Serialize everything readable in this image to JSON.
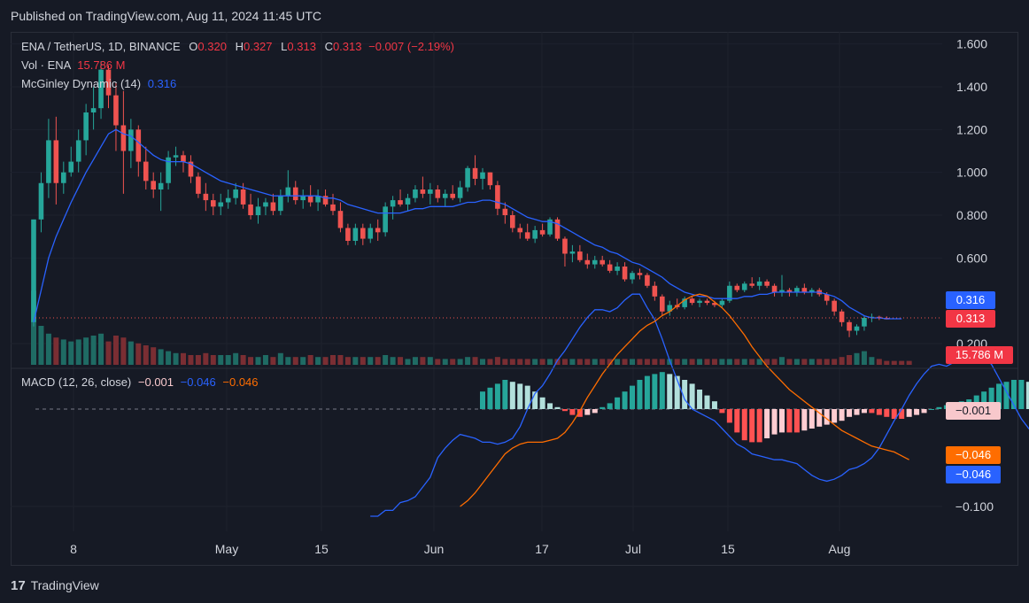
{
  "header": {
    "published": "Published on TradingView.com, Aug 11, 2024 11:45 UTC"
  },
  "footer": {
    "brand": "TradingView"
  },
  "colors": {
    "up": "#26a69a",
    "down": "#ef5350",
    "mcginley": "#2962ff",
    "macd_line": "#2962ff",
    "signal_line": "#ff6d00",
    "bg": "#161a25"
  },
  "legend": {
    "symbol": "ENA / TetherUS, 1D, BINANCE",
    "o_label": "O",
    "o": "0.320",
    "h_label": "H",
    "h": "0.327",
    "l_label": "L",
    "l": "0.313",
    "c_label": "C",
    "c": "0.313",
    "change": "−0.007 (−2.19%)",
    "vol_label": "Vol · ENA",
    "vol": "15.786 M",
    "mg_label": "McGinley Dynamic (14)",
    "mg": "0.316",
    "macd_label": "MACD (12, 26, close)",
    "macd_hist": "−0.001",
    "macd": "−0.046",
    "signal": "−0.046"
  },
  "badges": {
    "mcginley": "0.316",
    "last_price": "0.313",
    "volume": "15.786 M",
    "hist": "−0.001",
    "signal": "−0.046",
    "macd": "−0.046"
  },
  "chart_data": [
    {
      "type": "candlestick",
      "title": "ENA / TetherUS, 1D, BINANCE",
      "x_ticks": [
        "8",
        "May",
        "15",
        "Jun",
        "17",
        "Jul",
        "15",
        "Aug"
      ],
      "y_ticks": [
        "0.200",
        "0.600",
        "0.800",
        "1.000",
        "1.200",
        "1.400",
        "1.600"
      ],
      "ylim": [
        0.15,
        1.65
      ],
      "grid": true,
      "candles": [
        [
          0.3,
          0.78,
          0.28,
          0.78
        ],
        [
          0.78,
          1.0,
          0.72,
          0.95
        ],
        [
          0.95,
          1.25,
          0.88,
          1.15
        ],
        [
          1.15,
          1.26,
          0.85,
          0.95
        ],
        [
          0.95,
          1.05,
          0.9,
          1.0
        ],
        [
          1.0,
          1.12,
          0.98,
          1.05
        ],
        [
          1.05,
          1.2,
          1.0,
          1.15
        ],
        [
          1.15,
          1.32,
          1.08,
          1.28
        ],
        [
          1.28,
          1.4,
          1.2,
          1.3
        ],
        [
          1.3,
          1.52,
          1.25,
          1.48
        ],
        [
          1.48,
          1.5,
          1.3,
          1.36
        ],
        [
          1.36,
          1.42,
          1.1,
          1.22
        ],
        [
          1.22,
          1.38,
          0.9,
          1.1
        ],
        [
          1.1,
          1.25,
          1.02,
          1.2
        ],
        [
          1.2,
          1.22,
          0.98,
          1.05
        ],
        [
          1.05,
          1.12,
          0.92,
          0.96
        ],
        [
          0.96,
          1.0,
          0.88,
          0.92
        ],
        [
          0.92,
          1.0,
          0.82,
          0.95
        ],
        [
          0.95,
          1.1,
          0.92,
          1.07
        ],
        [
          1.07,
          1.12,
          1.03,
          1.08
        ],
        [
          1.08,
          1.1,
          1.0,
          1.05
        ],
        [
          1.05,
          1.08,
          0.95,
          0.98
        ],
        [
          0.98,
          1.0,
          0.88,
          0.9
        ],
        [
          0.9,
          0.95,
          0.82,
          0.87
        ],
        [
          0.87,
          0.9,
          0.8,
          0.84
        ],
        [
          0.84,
          0.9,
          0.8,
          0.86
        ],
        [
          0.86,
          0.92,
          0.83,
          0.88
        ],
        [
          0.88,
          0.95,
          0.85,
          0.92
        ],
        [
          0.92,
          0.95,
          0.83,
          0.85
        ],
        [
          0.85,
          0.9,
          0.78,
          0.8
        ],
        [
          0.8,
          0.88,
          0.76,
          0.84
        ],
        [
          0.84,
          0.88,
          0.8,
          0.86
        ],
        [
          0.86,
          0.9,
          0.8,
          0.82
        ],
        [
          0.82,
          0.92,
          0.8,
          0.89
        ],
        [
          0.89,
          1.01,
          0.86,
          0.93
        ],
        [
          0.93,
          0.96,
          0.85,
          0.87
        ],
        [
          0.87,
          0.92,
          0.83,
          0.89
        ],
        [
          0.89,
          0.94,
          0.84,
          0.86
        ],
        [
          0.86,
          0.92,
          0.82,
          0.89
        ],
        [
          0.89,
          0.92,
          0.84,
          0.85
        ],
        [
          0.85,
          0.9,
          0.8,
          0.82
        ],
        [
          0.82,
          0.86,
          0.72,
          0.74
        ],
        [
          0.74,
          0.76,
          0.66,
          0.68
        ],
        [
          0.68,
          0.76,
          0.66,
          0.74
        ],
        [
          0.74,
          0.76,
          0.66,
          0.69
        ],
        [
          0.69,
          0.76,
          0.67,
          0.74
        ],
        [
          0.74,
          0.78,
          0.68,
          0.72
        ],
        [
          0.72,
          0.86,
          0.7,
          0.84
        ],
        [
          0.84,
          0.89,
          0.78,
          0.87
        ],
        [
          0.87,
          0.92,
          0.84,
          0.85
        ],
        [
          0.85,
          0.9,
          0.82,
          0.88
        ],
        [
          0.88,
          0.94,
          0.86,
          0.92
        ],
        [
          0.92,
          0.98,
          0.88,
          0.9
        ],
        [
          0.9,
          0.95,
          0.85,
          0.92
        ],
        [
          0.92,
          0.94,
          0.86,
          0.88
        ],
        [
          0.88,
          0.92,
          0.84,
          0.9
        ],
        [
          0.9,
          0.94,
          0.87,
          0.88
        ],
        [
          0.88,
          0.96,
          0.86,
          0.93
        ],
        [
          0.93,
          1.03,
          0.91,
          1.02
        ],
        [
          1.02,
          1.08,
          0.94,
          0.97
        ],
        [
          0.97,
          1.02,
          0.92,
          1.0
        ],
        [
          1.0,
          1.0,
          0.92,
          0.94
        ],
        [
          0.94,
          0.96,
          0.8,
          0.83
        ],
        [
          0.83,
          0.86,
          0.76,
          0.8
        ],
        [
          0.8,
          0.82,
          0.72,
          0.74
        ],
        [
          0.74,
          0.76,
          0.69,
          0.72
        ],
        [
          0.72,
          0.76,
          0.68,
          0.69
        ],
        [
          0.69,
          0.75,
          0.67,
          0.73
        ],
        [
          0.73,
          0.76,
          0.7,
          0.71
        ],
        [
          0.71,
          0.79,
          0.7,
          0.78
        ],
        [
          0.78,
          0.79,
          0.68,
          0.69
        ],
        [
          0.69,
          0.7,
          0.56,
          0.62
        ],
        [
          0.62,
          0.66,
          0.58,
          0.63
        ],
        [
          0.63,
          0.66,
          0.58,
          0.59
        ],
        [
          0.59,
          0.62,
          0.55,
          0.57
        ],
        [
          0.57,
          0.61,
          0.55,
          0.59
        ],
        [
          0.59,
          0.61,
          0.56,
          0.57
        ],
        [
          0.57,
          0.59,
          0.53,
          0.54
        ],
        [
          0.54,
          0.58,
          0.52,
          0.56
        ],
        [
          0.56,
          0.58,
          0.49,
          0.5
        ],
        [
          0.5,
          0.54,
          0.48,
          0.53
        ],
        [
          0.53,
          0.55,
          0.5,
          0.52
        ],
        [
          0.52,
          0.53,
          0.46,
          0.47
        ],
        [
          0.47,
          0.49,
          0.4,
          0.42
        ],
        [
          0.42,
          0.43,
          0.33,
          0.35
        ],
        [
          0.35,
          0.4,
          0.33,
          0.38
        ],
        [
          0.38,
          0.41,
          0.36,
          0.37
        ],
        [
          0.37,
          0.42,
          0.36,
          0.41
        ],
        [
          0.41,
          0.42,
          0.38,
          0.39
        ],
        [
          0.39,
          0.41,
          0.37,
          0.4
        ],
        [
          0.4,
          0.41,
          0.38,
          0.39
        ],
        [
          0.39,
          0.4,
          0.37,
          0.38
        ],
        [
          0.38,
          0.41,
          0.37,
          0.4
        ],
        [
          0.4,
          0.49,
          0.39,
          0.47
        ],
        [
          0.47,
          0.48,
          0.44,
          0.45
        ],
        [
          0.45,
          0.49,
          0.44,
          0.48
        ],
        [
          0.48,
          0.51,
          0.46,
          0.47
        ],
        [
          0.47,
          0.51,
          0.45,
          0.49
        ],
        [
          0.49,
          0.5,
          0.46,
          0.47
        ],
        [
          0.47,
          0.48,
          0.42,
          0.44
        ],
        [
          0.44,
          0.52,
          0.42,
          0.45
        ],
        [
          0.45,
          0.46,
          0.42,
          0.44
        ],
        [
          0.44,
          0.47,
          0.42,
          0.46
        ],
        [
          0.46,
          0.48,
          0.43,
          0.44
        ],
        [
          0.44,
          0.46,
          0.42,
          0.45
        ],
        [
          0.45,
          0.46,
          0.42,
          0.43
        ],
        [
          0.43,
          0.44,
          0.38,
          0.4
        ],
        [
          0.4,
          0.41,
          0.33,
          0.35
        ],
        [
          0.35,
          0.36,
          0.28,
          0.3
        ],
        [
          0.3,
          0.31,
          0.23,
          0.26
        ],
        [
          0.26,
          0.29,
          0.24,
          0.28
        ],
        [
          0.28,
          0.33,
          0.26,
          0.32
        ],
        [
          0.32,
          0.34,
          0.3,
          0.325
        ],
        [
          0.325,
          0.33,
          0.31,
          0.32
        ],
        [
          0.32,
          0.327,
          0.313,
          0.313
        ]
      ],
      "mcginley": [
        0.3,
        0.45,
        0.6,
        0.7,
        0.78,
        0.86,
        0.93,
        1.0,
        1.06,
        1.12,
        1.18,
        1.2,
        1.18,
        1.17,
        1.14,
        1.11,
        1.08,
        1.06,
        1.05,
        1.05,
        1.05,
        1.04,
        1.02,
        1.0,
        0.98,
        0.96,
        0.95,
        0.94,
        0.93,
        0.92,
        0.91,
        0.9,
        0.89,
        0.89,
        0.89,
        0.89,
        0.89,
        0.89,
        0.89,
        0.88,
        0.88,
        0.87,
        0.85,
        0.84,
        0.83,
        0.82,
        0.81,
        0.81,
        0.81,
        0.81,
        0.82,
        0.83,
        0.83,
        0.84,
        0.84,
        0.84,
        0.84,
        0.85,
        0.86,
        0.86,
        0.87,
        0.87,
        0.86,
        0.85,
        0.83,
        0.81,
        0.79,
        0.78,
        0.77,
        0.77,
        0.76,
        0.74,
        0.72,
        0.7,
        0.68,
        0.66,
        0.65,
        0.63,
        0.62,
        0.6,
        0.58,
        0.57,
        0.55,
        0.53,
        0.51,
        0.48,
        0.46,
        0.44,
        0.43,
        0.42,
        0.42,
        0.41,
        0.41,
        0.41,
        0.41,
        0.42,
        0.42,
        0.43,
        0.43,
        0.44,
        0.44,
        0.44,
        0.44,
        0.44,
        0.44,
        0.44,
        0.43,
        0.42,
        0.4,
        0.37,
        0.35,
        0.33,
        0.32,
        0.32,
        0.316,
        0.316,
        0.316
      ]
    },
    {
      "type": "bar",
      "title": "Vol · ENA",
      "values": [
        38,
        20,
        16,
        14,
        13,
        12,
        13,
        14,
        15,
        16,
        12,
        15,
        14,
        12,
        11,
        10,
        9,
        8,
        7,
        6,
        6,
        5,
        5,
        6,
        5,
        5,
        5,
        6,
        5,
        4,
        4,
        5,
        4,
        6,
        4,
        4,
        4,
        5,
        4,
        4,
        5,
        5,
        4,
        4,
        4,
        4,
        4,
        5,
        4,
        4,
        3,
        4,
        4,
        4,
        3,
        3,
        3,
        3,
        4,
        4,
        3,
        3,
        4,
        3,
        3,
        3,
        3,
        3,
        3,
        3,
        3,
        3,
        3,
        3,
        3,
        3,
        3,
        3,
        3,
        3,
        3,
        3,
        3,
        3,
        3,
        3,
        3,
        3,
        3,
        3,
        3,
        3,
        3,
        3,
        3,
        3,
        3,
        3,
        3,
        3,
        4,
        3,
        3,
        3,
        3,
        3,
        3,
        3,
        4,
        5,
        6,
        7,
        4,
        3,
        2,
        2,
        2,
        2
      ]
    },
    {
      "type": "line",
      "title": "MACD (12, 26, close)",
      "y_ticks": [
        "−0.100"
      ],
      "hist_start": 60,
      "macd_start": 45,
      "signal_start": 57,
      "histogram": [
        0.018,
        0.022,
        0.026,
        0.03,
        0.028,
        0.026,
        0.024,
        0.018,
        0.012,
        0.006,
        0.002,
        -0.002,
        -0.006,
        -0.008,
        -0.006,
        -0.004,
        0.002,
        0.006,
        0.012,
        0.018,
        0.024,
        0.03,
        0.034,
        0.036,
        0.038,
        0.036,
        0.034,
        0.03,
        0.026,
        0.02,
        0.014,
        0.008,
        -0.004,
        -0.014,
        -0.024,
        -0.032,
        -0.034,
        -0.034,
        -0.03,
        -0.026,
        -0.024,
        -0.024,
        -0.024,
        -0.022,
        -0.02,
        -0.018,
        -0.016,
        -0.014,
        -0.012,
        -0.008,
        -0.006,
        -0.004,
        -0.004,
        -0.006,
        -0.008,
        -0.01,
        -0.01,
        -0.008,
        -0.006,
        -0.004,
        0.0,
        0.002,
        0.004,
        0.006,
        0.008,
        0.01,
        0.014,
        0.018,
        0.022,
        0.026,
        0.028,
        0.03,
        0.03,
        0.028,
        0.024,
        0.02,
        0.016,
        0.014,
        0.012,
        0.01,
        0.006,
        0.002,
        -0.002,
        -0.006,
        -0.01,
        -0.012,
        -0.014,
        -0.014,
        -0.01,
        -0.006,
        -0.004,
        -0.002,
        -0.001
      ],
      "macd": [
        -0.11,
        -0.11,
        -0.104,
        -0.104,
        -0.096,
        -0.094,
        -0.09,
        -0.08,
        -0.07,
        -0.05,
        -0.04,
        -0.032,
        -0.026,
        -0.028,
        -0.03,
        -0.034,
        -0.034,
        -0.036,
        -0.034,
        -0.03,
        -0.018,
        0.0,
        0.016,
        0.024,
        0.036,
        0.05,
        0.06,
        0.072,
        0.084,
        0.094,
        0.102,
        0.102,
        0.1,
        0.104,
        0.112,
        0.118,
        0.118,
        0.104,
        0.092,
        0.072,
        0.05,
        0.03,
        0.01,
        0.0,
        -0.004,
        -0.008,
        -0.012,
        -0.02,
        -0.028,
        -0.036,
        -0.04,
        -0.046,
        -0.048,
        -0.05,
        -0.052,
        -0.052,
        -0.054,
        -0.056,
        -0.062,
        -0.068,
        -0.072,
        -0.074,
        -0.072,
        -0.068,
        -0.062,
        -0.06,
        -0.056,
        -0.05,
        -0.04,
        -0.026,
        -0.012,
        0.0,
        0.014,
        0.026,
        0.036,
        0.044,
        0.046,
        0.044,
        0.048,
        0.05,
        0.052,
        0.054,
        0.052,
        0.046,
        0.032,
        0.018,
        0.004,
        -0.01,
        -0.02,
        -0.026,
        -0.034,
        -0.04,
        -0.04,
        -0.044,
        -0.046,
        -0.046
      ],
      "signal": [
        -0.1,
        -0.094,
        -0.086,
        -0.076,
        -0.066,
        -0.056,
        -0.046,
        -0.04,
        -0.036,
        -0.034,
        -0.034,
        -0.034,
        -0.032,
        -0.03,
        -0.024,
        -0.014,
        -0.002,
        0.012,
        0.024,
        0.036,
        0.046,
        0.056,
        0.064,
        0.072,
        0.08,
        0.086,
        0.09,
        0.096,
        0.1,
        0.106,
        0.112,
        0.116,
        0.118,
        0.116,
        0.11,
        0.104,
        0.096,
        0.086,
        0.076,
        0.064,
        0.054,
        0.044,
        0.036,
        0.028,
        0.02,
        0.014,
        0.008,
        0.002,
        -0.004,
        -0.01,
        -0.016,
        -0.022,
        -0.026,
        -0.03,
        -0.034,
        -0.038,
        -0.04,
        -0.042,
        -0.044,
        -0.048,
        -0.052,
        -0.056,
        -0.06,
        -0.064,
        -0.066,
        -0.068,
        -0.07,
        -0.07,
        -0.07,
        -0.068,
        -0.066,
        -0.06,
        -0.05,
        -0.04,
        -0.03,
        -0.02,
        -0.01,
        0.0,
        0.008,
        0.016,
        0.022,
        0.028,
        0.034,
        0.038,
        0.04,
        0.042,
        0.044,
        0.046,
        0.046,
        0.046,
        0.044,
        0.04,
        0.032,
        0.02,
        0.01,
        0.0,
        -0.01,
        -0.02,
        -0.03,
        -0.036,
        -0.04,
        -0.042,
        -0.044,
        -0.046,
        -0.046,
        -0.046,
        -0.046,
        -0.046,
        -0.046,
        -0.046,
        -0.046,
        -0.046,
        -0.046,
        -0.046,
        -0.046,
        -0.046,
        -0.046,
        -0.046,
        -0.046,
        -0.046,
        -0.046,
        -0.046
      ]
    }
  ]
}
